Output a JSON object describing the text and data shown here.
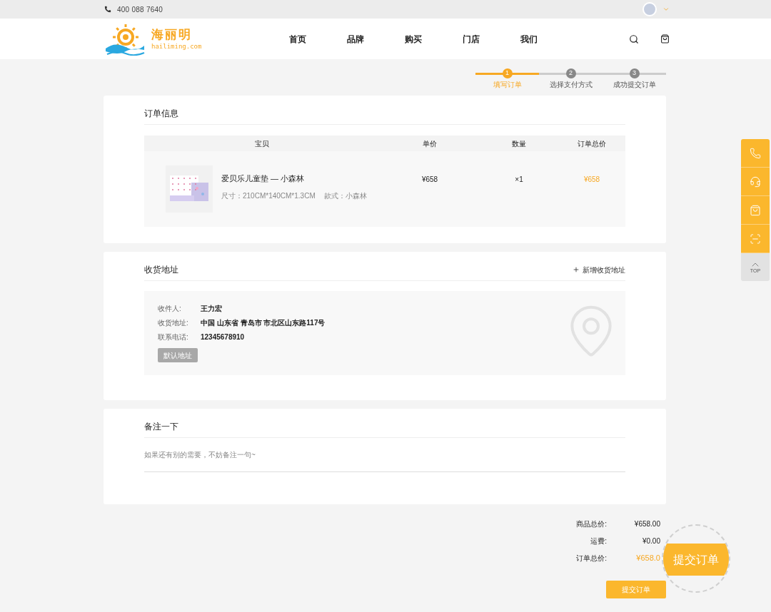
{
  "top_bar": {
    "phone": "400 088 7640"
  },
  "logo": {
    "name": "海丽明",
    "domain": "hailiming.com"
  },
  "nav": [
    {
      "label": "首页"
    },
    {
      "label": "品牌"
    },
    {
      "label": "购买"
    },
    {
      "label": "门店"
    },
    {
      "label": "我们"
    }
  ],
  "steps": [
    {
      "number": "1",
      "label": "填写订单",
      "selected": true
    },
    {
      "number": "2",
      "label": "选择支付方式",
      "selected": false
    },
    {
      "number": "3",
      "label": "成功提交订单",
      "selected": false
    }
  ],
  "order": {
    "title": "订单信息",
    "columns": [
      "宝贝",
      "单价",
      "数量",
      "订单总价"
    ],
    "items": [
      {
        "name": "爱贝乐儿童垫 — 小森林",
        "size": "尺寸：210CM*140CM*1.3CM",
        "style": "款式：小森林",
        "price": "¥658",
        "quantity": "×1",
        "total": "¥658"
      }
    ]
  },
  "address": {
    "title": "收货地址",
    "add_link": "新增收货地址",
    "fields": [
      {
        "label": "收件人:",
        "value": "王力宏"
      },
      {
        "label": "收货地址:",
        "value": "中国 山东省 青岛市 市北区山东路117号"
      },
      {
        "label": "联系电话:",
        "value": "12345678910"
      }
    ],
    "default_button": {
      "label": "默认地址",
      "disabled": true
    }
  },
  "note": {
    "title": "备注一下",
    "placeholder": "如果还有别的需要，不妨备注一句~"
  },
  "totals": [
    {
      "label": "商品总价:",
      "value": "¥658.00",
      "kind": "plain"
    },
    {
      "label": "运费:",
      "value": "¥0.00",
      "kind": "plain"
    },
    {
      "label": "订单总价:",
      "value": "¥658.0",
      "kind": "highlight"
    }
  ],
  "submit_button": "提交订单",
  "magnifier": {
    "label": "提交订单"
  },
  "side_tools": [
    {
      "kind": "phone"
    },
    {
      "kind": "service"
    },
    {
      "kind": "bag"
    },
    {
      "kind": "qr"
    },
    {
      "kind": "top",
      "label": "TOP"
    }
  ]
}
